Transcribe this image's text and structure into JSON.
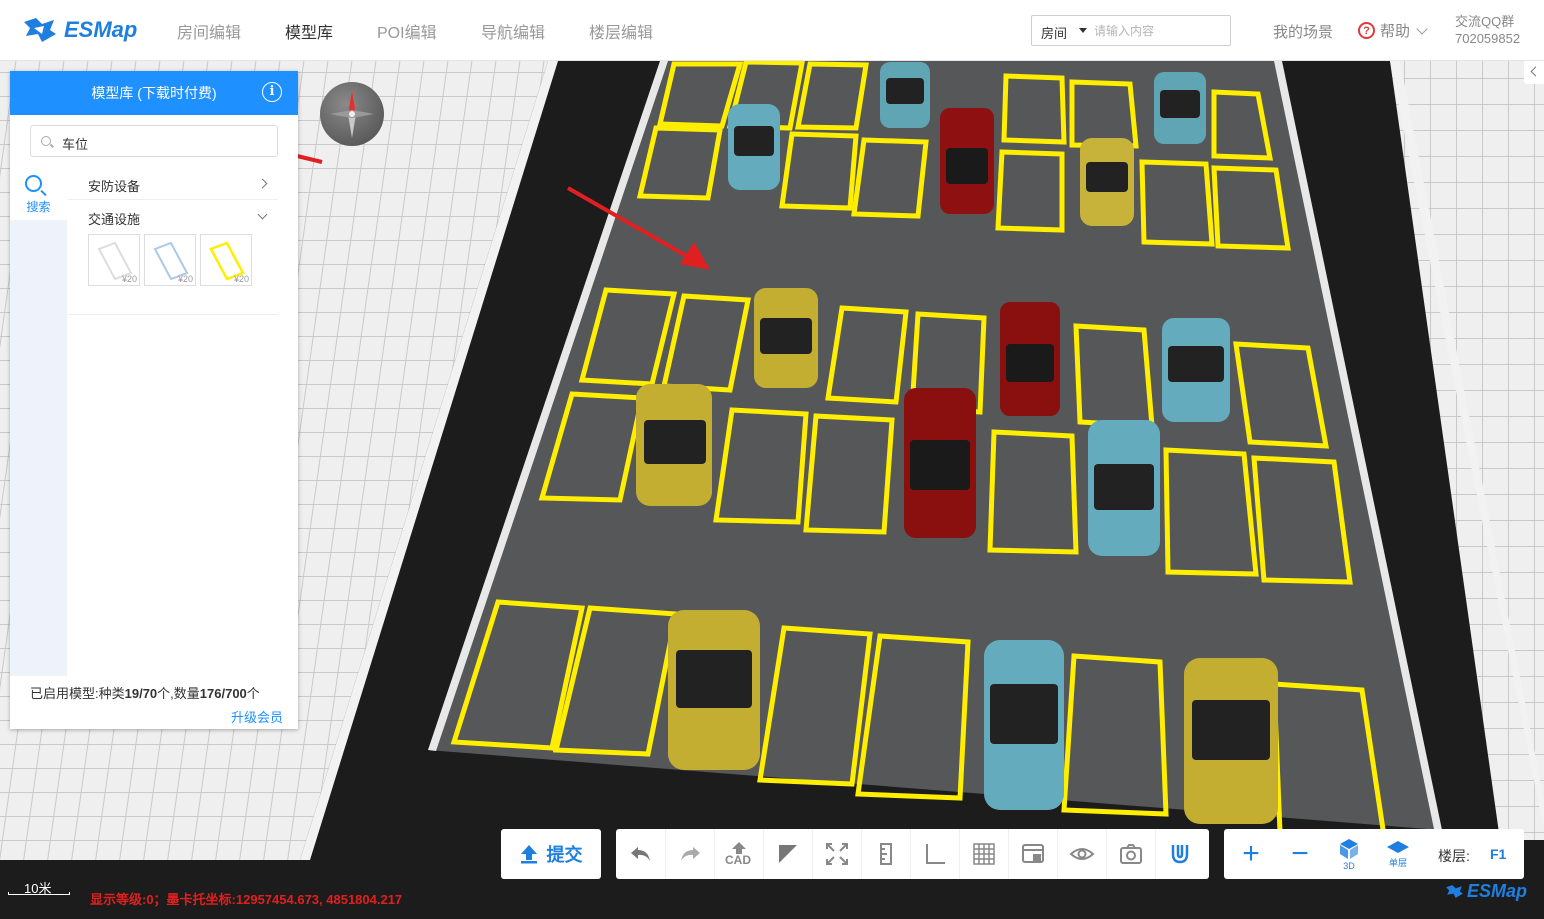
{
  "app": {
    "logo_text": "ESMap",
    "brand_color": "#1f7fe0"
  },
  "nav": {
    "tabs": [
      {
        "label": "房间编辑",
        "active": false
      },
      {
        "label": "模型库",
        "active": true
      },
      {
        "label": "POI编辑",
        "active": false
      },
      {
        "label": "导航编辑",
        "active": false
      },
      {
        "label": "楼层编辑",
        "active": false
      }
    ]
  },
  "search": {
    "type": "房间",
    "placeholder": "请输入内容"
  },
  "header_right": {
    "my_scene": "我的场景",
    "help": "帮助",
    "qq_label": "交流QQ群",
    "qq_number": "702059852"
  },
  "panel": {
    "title": "模型库 (下载时付费)",
    "search_value": "车位",
    "side_tab": "搜索",
    "categories": [
      {
        "label": "安防设备",
        "expanded": false
      },
      {
        "label": "交通设施",
        "expanded": true
      }
    ],
    "items": [
      {
        "price": "¥20",
        "color": "#ffffff"
      },
      {
        "price": "¥20",
        "color": "#a9c9e6"
      },
      {
        "price": "¥20",
        "color": "#ffee00"
      }
    ],
    "footer_prefix": "已启用模型:种类",
    "kinds": "19/70",
    "footer_mid": "个,数量",
    "count": "176/700",
    "footer_suffix": "个",
    "upgrade": "升级会员"
  },
  "toolbar": {
    "submit": "提交",
    "cad": "CAD",
    "tools": [
      "undo-icon",
      "redo-icon",
      "cad-upload-icon",
      "triangle-icon",
      "fullscreen-icon",
      "ruler-icon",
      "angle-icon",
      "grid-icon",
      "screen-icon",
      "eye-icon",
      "camera-icon",
      "magnet-icon"
    ]
  },
  "view": {
    "zoom_in": "+",
    "zoom_out": "−",
    "mode_3d": "3D",
    "single_floor": "单层",
    "floor_label": "楼层:",
    "floor_value": "F1"
  },
  "status": {
    "scale_text": "10米",
    "coords": "显示等级:0；墨卡托坐标:12957454.673, 4851804.217"
  },
  "colors": {
    "parking_line": "#ffee00",
    "accent": "#1e90ff",
    "arrow": "#e02020"
  }
}
